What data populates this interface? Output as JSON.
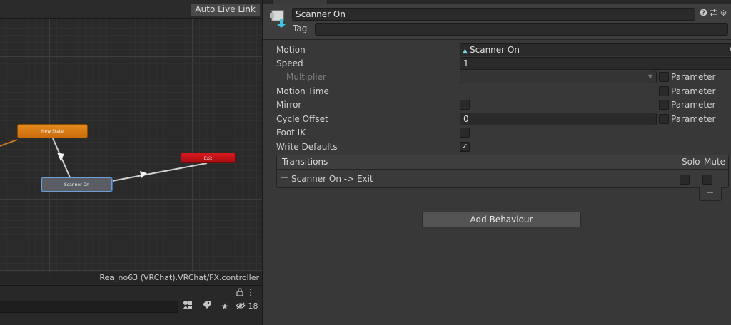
{
  "graph": {
    "auto_live_link": "Auto Live Link",
    "states": {
      "new_state": "New State",
      "exit": "Exit",
      "scanner_on": "Scanner On"
    },
    "controller_path": "Rea_no63 (VRChat).VRChat/FX.controller"
  },
  "project_bar": {
    "search_value": "",
    "hidden_count": "18",
    "icons": [
      "lock-icon",
      "kebab-menu-icon",
      "filter-by-type-icon",
      "label-icon",
      "star-icon",
      "eye-slash-icon"
    ]
  },
  "inspector": {
    "header": {
      "name": "Scanner On",
      "tag_label": "Tag",
      "tag_value": ""
    },
    "props": {
      "motion_label": "Motion",
      "motion_value": "Scanner On",
      "speed_label": "Speed",
      "speed_value": "1",
      "multiplier_label": "Multiplier",
      "multiplier_value": "",
      "motion_time_label": "Motion Time",
      "mirror_label": "Mirror",
      "cycle_offset_label": "Cycle Offset",
      "cycle_offset_value": "0",
      "foot_ik_label": "Foot IK",
      "write_defaults_label": "Write Defaults",
      "write_defaults_checked": "✓",
      "parameter_label": "Parameter"
    },
    "transitions": {
      "title": "Transitions",
      "solo": "Solo",
      "mute": "Mute",
      "items": [
        {
          "name": "Scanner On -> Exit"
        }
      ],
      "remove_label": "−"
    },
    "add_behaviour": "Add Behaviour"
  },
  "colors": {
    "new_state": "#e0841a",
    "exit_state": "#c4141a",
    "selected_state_border": "#6d9ed6",
    "inspector_bg": "#383838",
    "graph_bg": "#2a2a2a"
  }
}
